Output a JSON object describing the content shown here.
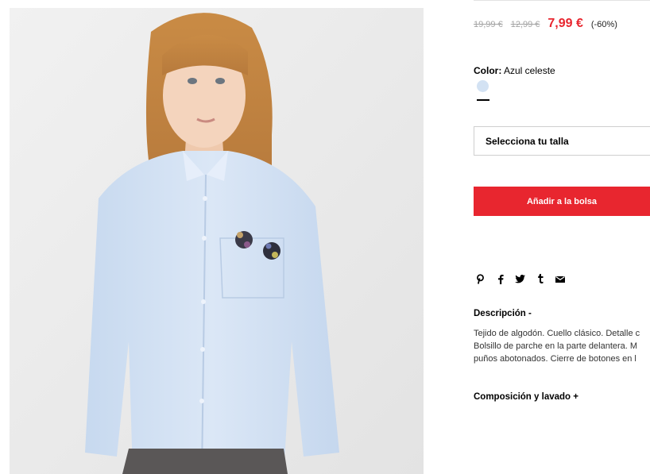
{
  "product": {
    "price_original_1": "19,99 €",
    "price_original_2": "12,99 €",
    "price_current": "7,99 €",
    "discount": "(-60%)",
    "color_label": "Color:",
    "color_value": "Azul celeste",
    "swatch_color": "#d3e2f3",
    "accent_color": "#e8262f"
  },
  "size_select": {
    "placeholder": "Selecciona tu talla"
  },
  "add_to_bag": {
    "label": "Añadir a la bolsa"
  },
  "share_icons": [
    "pinterest-icon",
    "facebook-icon",
    "twitter-icon",
    "tumblr-icon",
    "email-icon"
  ],
  "description": {
    "title": "Descripción -",
    "lines": [
      "Tejido de algodón. Cuello clásico. Detalle c",
      "Bolsillo de parche en la parte delantera. M",
      "puños abotonados. Cierre de botones en l"
    ]
  },
  "composition": {
    "title": "Composición y lavado +"
  }
}
